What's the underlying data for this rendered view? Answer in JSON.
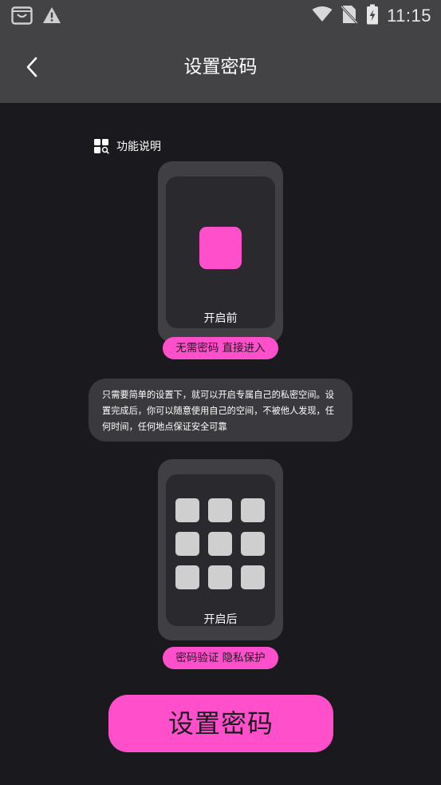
{
  "status_bar": {
    "time": "11:15",
    "icons": [
      "shopping-bag-icon",
      "warning-icon",
      "wifi-icon",
      "no-sim-icon",
      "battery-charging-icon"
    ]
  },
  "nav": {
    "back_icon": "chevron-left-icon",
    "title": "设置密码"
  },
  "feature": {
    "label": "功能说明",
    "icon": "grid-search-icon"
  },
  "before": {
    "caption": "开启前",
    "badge": "无需密码 直接进入"
  },
  "description": "只需要简单的设置下，就可以开启专属自己的私密空间。设置完成后，你可以随意使用自己的空间，不被他人发现，任何时间，任何地点保证安全可靠",
  "after": {
    "caption": "开启后",
    "badge": "密码验证 隐私保护"
  },
  "primary_button": {
    "label": "设置密码"
  },
  "colors": {
    "accent": "#ff4fcb",
    "background": "#1a191d",
    "header": "#434244"
  }
}
